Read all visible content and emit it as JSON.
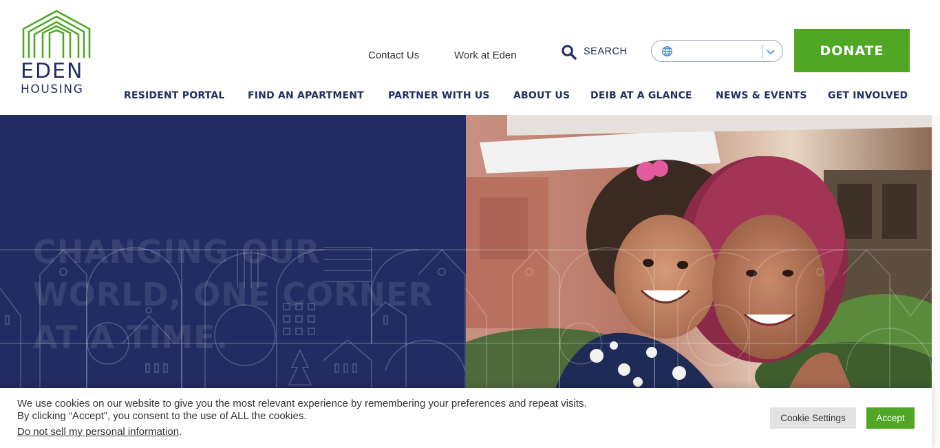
{
  "brand": {
    "name_line1": "EDEN",
    "name_line2": "HOUSING",
    "logo_color": "#50a725",
    "text_color": "#232e62"
  },
  "utility_nav": {
    "contact": "Contact Us",
    "work": "Work at Eden",
    "search_label": "SEARCH",
    "language_selected": "",
    "donate": "DONATE"
  },
  "main_nav": [
    "RESIDENT PORTAL",
    "FIND AN APARTMENT",
    "PARTNER WITH US",
    "ABOUT US",
    "DEIB AT A GLANCE",
    "NEWS & EVENTS",
    "GET INVOLVED"
  ],
  "hero": {
    "title": "CHANGING OUR WORLD, ONE CORNER AT A TIME.",
    "background_color": "#232b63",
    "image_alt": "mother and daughter smiling"
  },
  "cookie_bar": {
    "line1": "We use cookies on our website to give you the most relevant experience by remembering your preferences and repeat visits.",
    "line2": "By clicking “Accept”, you consent to the use of ALL the cookies.",
    "link_text": "Do not sell my personal information",
    "link_suffix": ".",
    "settings_label": "Cookie Settings",
    "accept_label": "Accept"
  },
  "colors": {
    "accent_green": "#50a725",
    "navy": "#232e62"
  }
}
